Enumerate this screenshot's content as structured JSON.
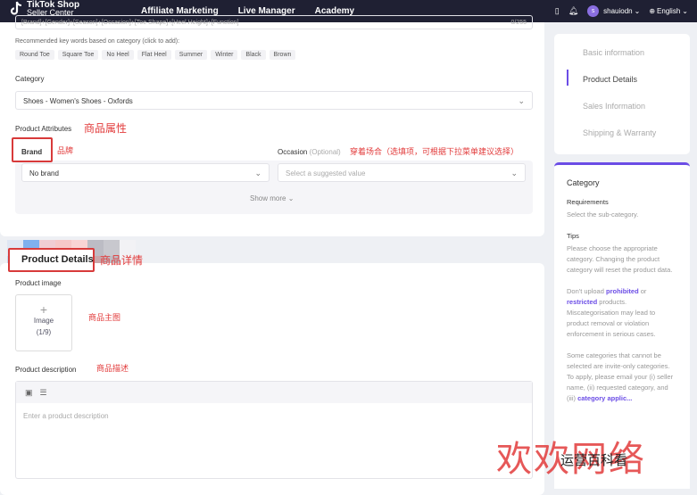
{
  "header": {
    "logo_title": "TikTok Shop",
    "logo_subtitle": "Seller Center",
    "nav": [
      "Affiliate Marketing",
      "Live Manager",
      "Academy"
    ],
    "username": "shauiodn",
    "language": "English"
  },
  "form": {
    "title_hint_placeholder": "[Brand]+[Gender]+[Season]+[Occasion]+[Toe Shape]+[Heel Height]+[Function]",
    "title_hint_count": "0/255",
    "recommended_label": "Recommended key words based on category (click to add):",
    "keywords": [
      "Round Toe",
      "Square Toe",
      "No Heel",
      "Flat Heel",
      "Summer",
      "Winter",
      "Black",
      "Brown"
    ],
    "category_label": "Category",
    "category_value": "Shoes - Women's Shoes - Oxfords",
    "attributes_label": "Product Attributes",
    "attributes_note": "商品属性",
    "brand_label": "Brand",
    "brand_note": "品牌",
    "brand_value": "No brand",
    "occasion_label": "Occasion",
    "occasion_optional": "(Optional)",
    "occasion_note": "穿着场合（选填项，可根据下拉菜单建议选择）",
    "occasion_placeholder": "Select a suggested value",
    "show_more": "Show more",
    "details_title": "Product Details",
    "details_note": "商品详情",
    "image_label": "Product image",
    "image_box_label": "Image",
    "image_count": "(1/9)",
    "image_note": "商品主图",
    "description_label": "Product description",
    "description_note": "商品描述",
    "description_placeholder": "Enter a product description"
  },
  "steps": [
    "Basic information",
    "Product Details",
    "Sales Information",
    "Shipping & Warranty"
  ],
  "info": {
    "title": "Category",
    "req_title": "Requirements",
    "req_text": "Select the sub-category.",
    "tips_title": "Tips",
    "tip1": "Please choose the appropriate category. Changing the product category will reset the product data.",
    "tip2_a": "Don't upload",
    "tip2_b": "prohibited",
    "tip2_c": "or",
    "tip2_d": "restricted",
    "tip2_e": "products. Miscategorisation may lead to product removal or violation enforcement in serious cases.",
    "tip3": "Some categories that cannot be selected are invite-only categories. To apply, please email your (i) seller name, (ii) requested category, and (iii)",
    "tip3_link": "category applic..."
  },
  "watermark": {
    "big": "欢欢网络",
    "small": "运营百科看"
  },
  "colors": {
    "accent": "#6b4de6",
    "annotation_red": "#e23b3b",
    "topbar": "#1f2033"
  }
}
